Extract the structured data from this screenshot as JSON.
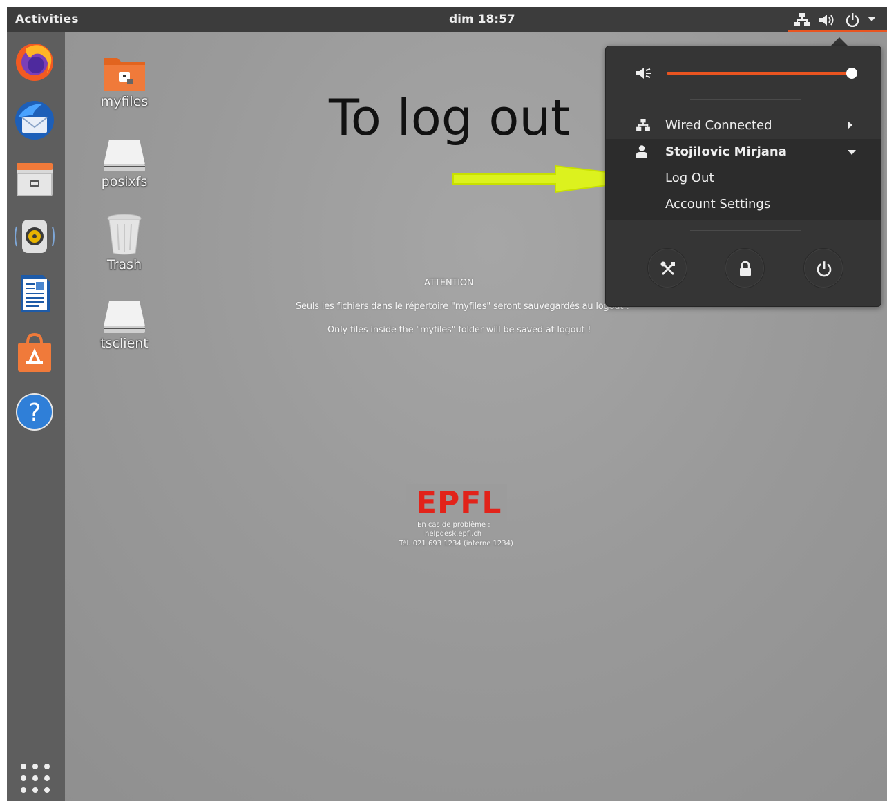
{
  "topbar": {
    "activities": "Activities",
    "clock": "dim 18:57",
    "tray_icons": [
      "network-icon",
      "volume-icon",
      "power-icon",
      "dropdown-arrow-icon"
    ],
    "accent": "#e95420"
  },
  "dock": {
    "apps": [
      "firefox",
      "thunderbird",
      "files",
      "rhythmbox",
      "libreoffice-writer",
      "ubuntu-software",
      "help"
    ],
    "show_apps": "apps-grid-icon"
  },
  "desktop": {
    "icons": [
      {
        "label": "myfiles"
      },
      {
        "label": "posixfs"
      },
      {
        "label": "Trash"
      },
      {
        "label": "tsclient"
      }
    ],
    "annotation": "To log out"
  },
  "notice": {
    "title": "ATTENTION",
    "french": "Seuls les fichiers dans le répertoire \"myfiles\" seront sauvegardés au logout !",
    "english": "Only files inside the \"myfiles\" folder will be saved at logout !"
  },
  "epfl": {
    "logo": "EPFL",
    "line1": "En cas de problème :",
    "line2": "helpdesk.epfl.ch",
    "line3": "Tél. 021 693 1234 (interne 1234)",
    "brand_color": "#e2231a"
  },
  "menu": {
    "volume_level": 1.0,
    "wired": "Wired Connected",
    "user": "Stojilovic Mirjana",
    "logout": "Log Out",
    "account_settings": "Account Settings",
    "buttons": [
      "settings-icon",
      "lock-icon",
      "power-icon"
    ]
  }
}
